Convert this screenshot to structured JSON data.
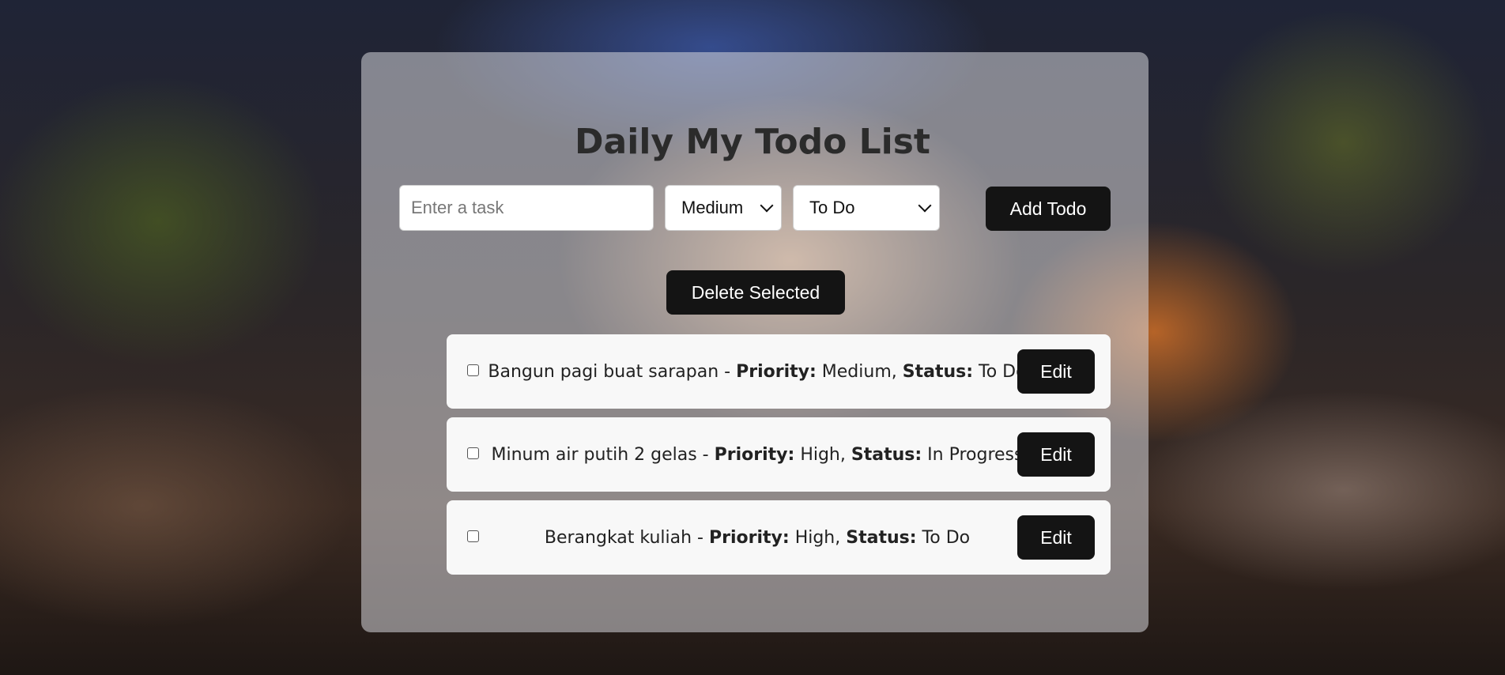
{
  "app": {
    "title": "Daily My Todo List"
  },
  "form": {
    "task_placeholder": "Enter a task",
    "task_value": "",
    "priority_selected": "Medium",
    "status_selected": "To Do",
    "add_button_label": "Add Todo"
  },
  "actions": {
    "delete_selected_label": "Delete Selected"
  },
  "labels": {
    "priority": "Priority:",
    "status": "Status:"
  },
  "todos": [
    {
      "task": "Bangun pagi buat sarapan",
      "priority": "Medium",
      "status": "To Do",
      "checked": false,
      "edit_label": "Edit"
    },
    {
      "task": "Minum air putih 2 gelas",
      "priority": "High",
      "status": "In Progress",
      "checked": false,
      "edit_label": "Edit"
    },
    {
      "task": "Berangkat kuliah",
      "priority": "High",
      "status": "To Do",
      "checked": false,
      "edit_label": "Edit"
    }
  ],
  "colors": {
    "button_bg": "#141414",
    "button_text": "#ffffff",
    "card_bg": "rgba(215,215,220,0.55)",
    "item_bg": "#f8f8f8",
    "title_text": "#2b2b2b"
  },
  "icons": {
    "select_arrow": "chevron-down-icon",
    "item_checkbox": "checkbox-icon"
  }
}
